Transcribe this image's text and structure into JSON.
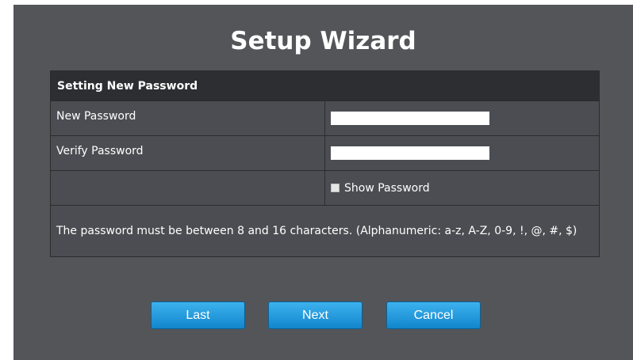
{
  "wizard": {
    "title": "Setup Wizard"
  },
  "form": {
    "section_title": "Setting New Password",
    "new_password_label": "New Password",
    "new_password_value": "",
    "verify_password_label": "Verify Password",
    "verify_password_value": "",
    "show_password_label": "Show Password",
    "show_password_checked": false,
    "note": "The password must be between 8 and 16 characters. (Alphanumeric: a-z, A-Z, 0-9, !, @, #, $)"
  },
  "buttons": {
    "last_label": "Last",
    "next_label": "Next",
    "cancel_label": "Cancel"
  },
  "colors": {
    "panel_bg": "#545559",
    "header_bg": "#2d2e31",
    "button_blue": "#1d96dc"
  }
}
